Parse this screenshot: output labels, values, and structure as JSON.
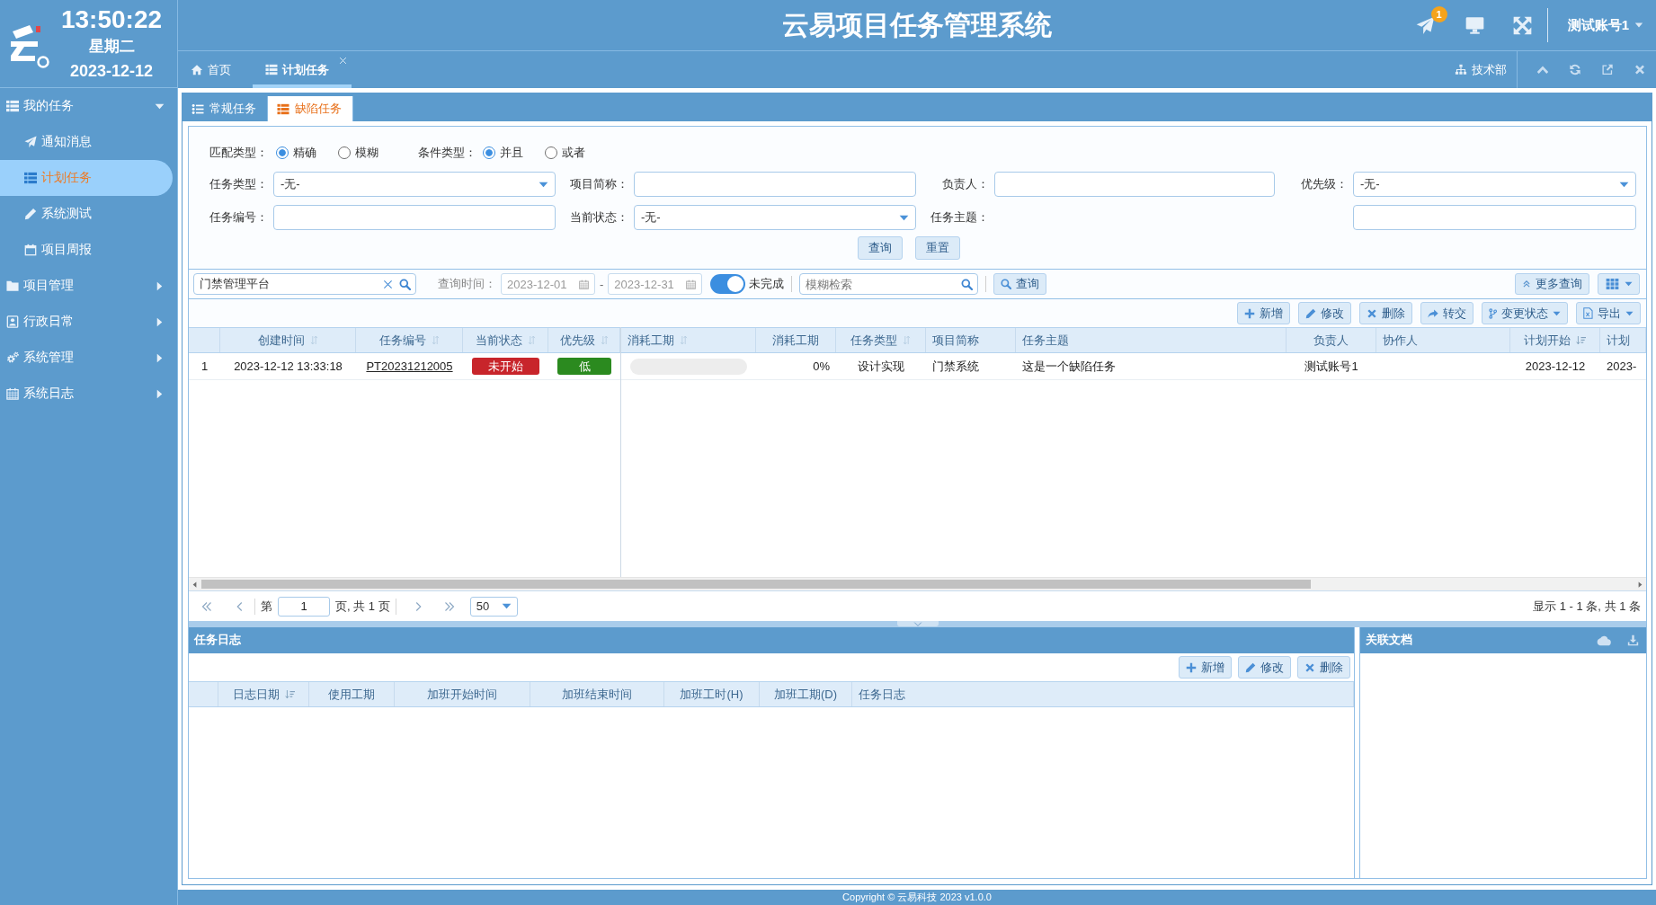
{
  "sidebar": {
    "clock": {
      "time": "13:50:22",
      "weekday": "星期二",
      "date": "2023-12-12"
    },
    "menu": [
      {
        "label": "我的任务",
        "expanded": true,
        "children": [
          {
            "label": "通知消息",
            "selected": false
          },
          {
            "label": "计划任务",
            "selected": true
          },
          {
            "label": "系统测试",
            "selected": false
          },
          {
            "label": "项目周报",
            "selected": false
          }
        ]
      },
      {
        "label": "项目管理",
        "expanded": false
      },
      {
        "label": "行政日常",
        "expanded": false
      },
      {
        "label": "系统管理",
        "expanded": false
      },
      {
        "label": "系统日志",
        "expanded": false
      }
    ]
  },
  "header": {
    "title": "云易项目任务管理系统",
    "notification_count": "1",
    "user": "测试账号1"
  },
  "page_tabs": [
    {
      "label": "首页",
      "selected": false,
      "closable": false
    },
    {
      "label": "计划任务",
      "selected": true,
      "closable": true
    }
  ],
  "department": "技术部",
  "sub_tabs": [
    {
      "label": "常规任务",
      "selected": false
    },
    {
      "label": "缺陷任务",
      "selected": true
    }
  ],
  "filter": {
    "radio_groups": [
      {
        "label": "匹配类型：",
        "options": [
          {
            "label": "精确",
            "selected": true
          },
          {
            "label": "模糊",
            "selected": false
          }
        ]
      },
      {
        "label": "条件类型：",
        "options": [
          {
            "label": "并且",
            "selected": true
          },
          {
            "label": "或者",
            "selected": false
          }
        ]
      }
    ],
    "fields": [
      {
        "label": "任务类型：",
        "kind": "select",
        "value": "-无-"
      },
      {
        "label": "项目简称：",
        "kind": "text"
      },
      {
        "label": "负责人：",
        "kind": "text"
      },
      {
        "label": "优先级：",
        "kind": "select",
        "value": "-无-"
      },
      {
        "label": "任务编号：",
        "kind": "text"
      },
      {
        "label": "当前状态：",
        "kind": "select",
        "value": "-无-"
      },
      {
        "label": "任务主题：",
        "kind": "text"
      }
    ],
    "buttons": [
      "查询",
      "重置"
    ]
  },
  "toolbar": {
    "project_search": {
      "value": "门禁管理平台"
    },
    "date_label": "查询时间：",
    "date_from": "2023-12-01",
    "date_separator": "-",
    "date_to": "2023-12-31",
    "incomplete_toggle": {
      "label": "未完成",
      "on": true
    },
    "keyword_search": {
      "placeholder": "模糊检索"
    },
    "query_button": "查询",
    "more_query_button": "更多查询"
  },
  "actions": [
    {
      "label": "新增",
      "dropdown": false
    },
    {
      "label": "修改",
      "dropdown": false
    },
    {
      "label": "删除",
      "dropdown": false
    },
    {
      "label": "转交",
      "dropdown": false
    },
    {
      "label": "变更状态",
      "dropdown": true
    },
    {
      "label": "导出",
      "dropdown": true
    }
  ],
  "table": {
    "columns": [
      {
        "label": "创建时间",
        "sortable": true,
        "sorted": false
      },
      {
        "label": "任务编号",
        "sortable": true,
        "sorted": false
      },
      {
        "label": "当前状态",
        "sortable": true,
        "sorted": false
      },
      {
        "label": "优先级",
        "sortable": true,
        "sorted": false
      },
      {
        "label": "消耗工期",
        "sortable": true,
        "sorted": false
      },
      {
        "label": "消耗工期",
        "sortable": false,
        "sorted": false
      },
      {
        "label": "任务类型",
        "sortable": true,
        "sorted": false
      },
      {
        "label": "项目简称",
        "sortable": false,
        "sorted": false
      },
      {
        "label": "任务主题",
        "sortable": false,
        "sorted": false
      },
      {
        "label": "负责人",
        "sortable": false,
        "sorted": false
      },
      {
        "label": "协作人",
        "sortable": false,
        "sorted": false
      },
      {
        "label": "计划开始",
        "sortable": true,
        "sorted": true
      },
      {
        "label": "计划",
        "sortable": false,
        "sorted": false
      }
    ],
    "rows": [
      {
        "number": "1",
        "created": "2023-12-12 13:33:18",
        "task_no": "PT20231212005",
        "status": {
          "label": "未开始",
          "color": "#c8252b"
        },
        "priority": {
          "label": "低",
          "color": "#2b8a1f"
        },
        "consumed_percent": "0%",
        "task_type": "设计实现",
        "project": "门禁系统",
        "subject": "这是一个缺陷任务",
        "owner": "测试账号1",
        "plan_start": "2023-12-12",
        "column_13": "2023-"
      }
    ]
  },
  "pagination": {
    "page_prefix": "第",
    "page": "1",
    "page_suffix": "页, 共 1 页",
    "page_size": "50",
    "summary": "显示 1 - 1 条, 共 1 条"
  },
  "log_panel": {
    "title": "任务日志",
    "actions": [
      "新增",
      "修改",
      "删除"
    ],
    "columns": [
      {
        "label": "日志日期",
        "sortable": true,
        "sorted": true
      },
      {
        "label": "使用工期",
        "sortable": false,
        "sorted": false
      },
      {
        "label": "加班开始时间",
        "sortable": false,
        "sorted": false
      },
      {
        "label": "加班结束时间",
        "sortable": false,
        "sorted": false
      },
      {
        "label": "加班工时(H)",
        "sortable": false,
        "sorted": false
      },
      {
        "label": "加班工期(D)",
        "sortable": false,
        "sorted": false
      },
      {
        "label": "任务日志",
        "sortable": false,
        "sorted": false
      }
    ]
  },
  "docs_panel": {
    "title": "关联文档"
  },
  "footer": "Copyright © 云易科技 2023 v1.0.0"
}
